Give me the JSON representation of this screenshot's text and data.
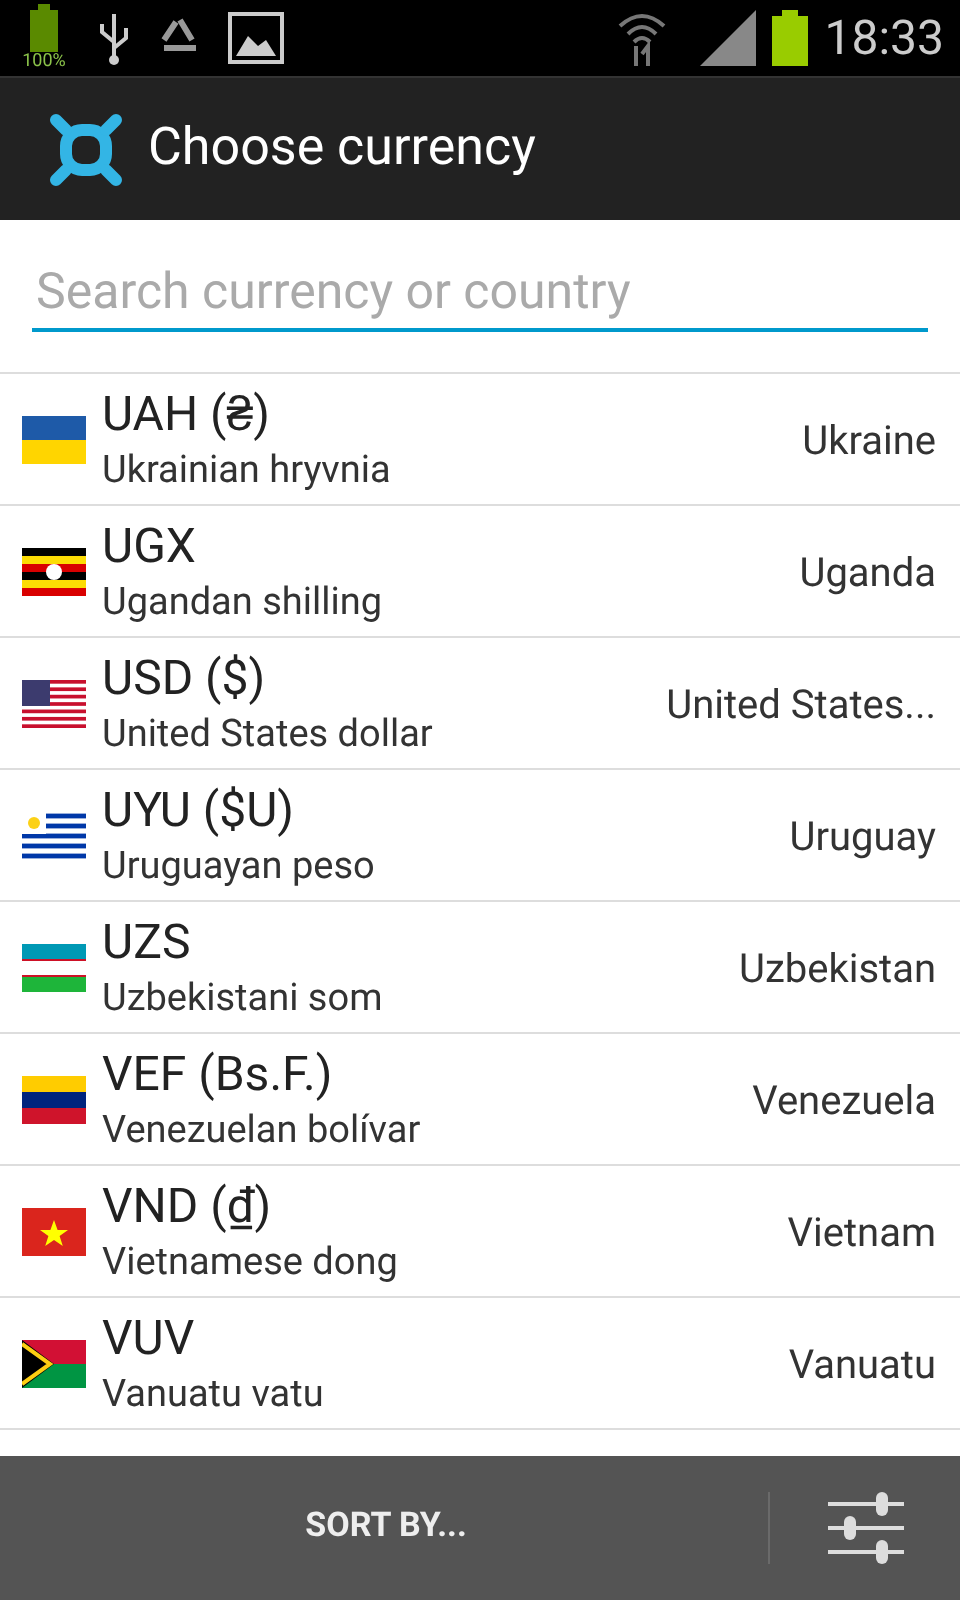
{
  "status_bar": {
    "battery_label": "100%",
    "time": "18:33"
  },
  "action_bar": {
    "title": "Choose currency"
  },
  "search": {
    "placeholder": "Search currency or country"
  },
  "currencies": [
    {
      "code": "UAH (₴)",
      "name": "Ukrainian hryvnia",
      "country": "Ukraine"
    },
    {
      "code": "UGX",
      "name": "Ugandan shilling",
      "country": "Uganda"
    },
    {
      "code": "USD ($)",
      "name": "United States dollar",
      "country": "United States..."
    },
    {
      "code": "UYU ($U)",
      "name": "Uruguayan peso",
      "country": "Uruguay"
    },
    {
      "code": "UZS",
      "name": "Uzbekistani som",
      "country": "Uzbekistan"
    },
    {
      "code": "VEF (Bs.F.)",
      "name": "Venezuelan bolívar",
      "country": "Venezuela"
    },
    {
      "code": "VND (₫)",
      "name": "Vietnamese dong",
      "country": "Vietnam"
    },
    {
      "code": "VUV",
      "name": "Vanuatu vatu",
      "country": "Vanuatu"
    }
  ],
  "bottom_bar": {
    "sort_label": "SORT BY..."
  }
}
